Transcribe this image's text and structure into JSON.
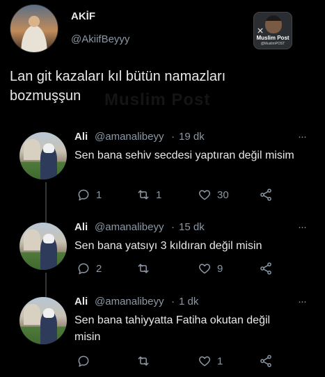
{
  "tweet": {
    "author_name": "AKİF",
    "author_handle": "@AkiifBeyyy",
    "text": "Lan git kazaları kıl bütün namazları bozmuşşun"
  },
  "brand_logo": {
    "title": "Muslim Post",
    "subtitle": "@MuslimPOST",
    "corner_icon": "x-logo-icon"
  },
  "watermark": "Muslim Post",
  "replies": [
    {
      "name": "Ali",
      "handle": "@amanalibeyy",
      "separator": "·",
      "time": "19 dk",
      "text": "Sen bana sehiv secdesi yaptıran değil misim",
      "reply_count": "1",
      "retweet_count": "1",
      "like_count": "30"
    },
    {
      "name": "Ali",
      "handle": "@amanalibeyy",
      "separator": "·",
      "time": "15 dk",
      "text": "Sen bana yatsıyı 3 kıldıran değil misin",
      "reply_count": "2",
      "retweet_count": "",
      "like_count": "9"
    },
    {
      "name": "Ali",
      "handle": "@amanalibeyy",
      "separator": "·",
      "time": "1 dk",
      "text": "Sen bana tahiyyatta Fatiha okutan değil misin",
      "reply_count": "",
      "retweet_count": "",
      "like_count": "1"
    }
  ],
  "icons": {
    "reply": "reply-icon",
    "retweet": "retweet-icon",
    "like": "heart-icon",
    "share": "share-icon",
    "more": "more-icon"
  },
  "colors": {
    "background": "#000000",
    "text": "#e7e9ea",
    "muted": "#8b98a5",
    "thread_line": "#333639"
  }
}
